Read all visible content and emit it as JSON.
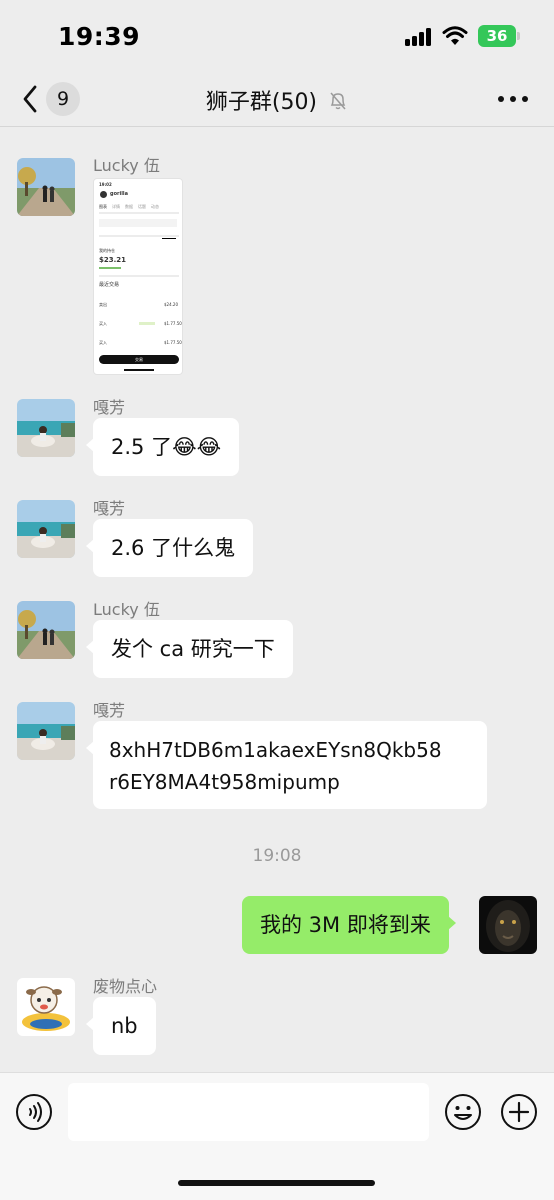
{
  "status_bar": {
    "time": "19:39",
    "battery": "36"
  },
  "nav": {
    "unread_count": "9",
    "title": "狮子群(50)"
  },
  "messages": [
    {
      "sender": "Lucky 伍",
      "type": "image"
    },
    {
      "sender": "嘎芳",
      "text": "2.5 了😂😂"
    },
    {
      "sender": "嘎芳",
      "text": "2.6 了什么鬼"
    },
    {
      "sender": "Lucky 伍",
      "text": "发个 ca 研究一下"
    },
    {
      "sender": "嘎芳",
      "text_line1": "8xhH7tDB6m1akaexEYsn8Qkb58",
      "text_line2": "r6EY8MA4t958mipump"
    },
    {
      "timestamp": "19:08"
    },
    {
      "sender": "",
      "self": true,
      "text": "我的 3M 即将到来"
    },
    {
      "sender": "废物点心",
      "text": "nb"
    }
  ],
  "screenshot": {
    "time": "19:02",
    "name": "gorilla",
    "tab1": "图表",
    "tab2": "详情",
    "tab3": "数据",
    "tab4": "话题",
    "tab5": "动态",
    "section_holdings": "我的持仓",
    "holding_value": "$23.21",
    "section_trades": "最近交易",
    "trade1": "卖出",
    "trade1_val": "$24.20",
    "trade2": "买入",
    "trade2_val": "$1.77.50",
    "trade3": "买入",
    "trade3_val": "$1.77.50",
    "button": "交易"
  },
  "input_bar": {
    "placeholder": ""
  },
  "colors": {
    "self_bubble": "#95ec69",
    "background": "#ededed",
    "battery": "#34c759"
  }
}
